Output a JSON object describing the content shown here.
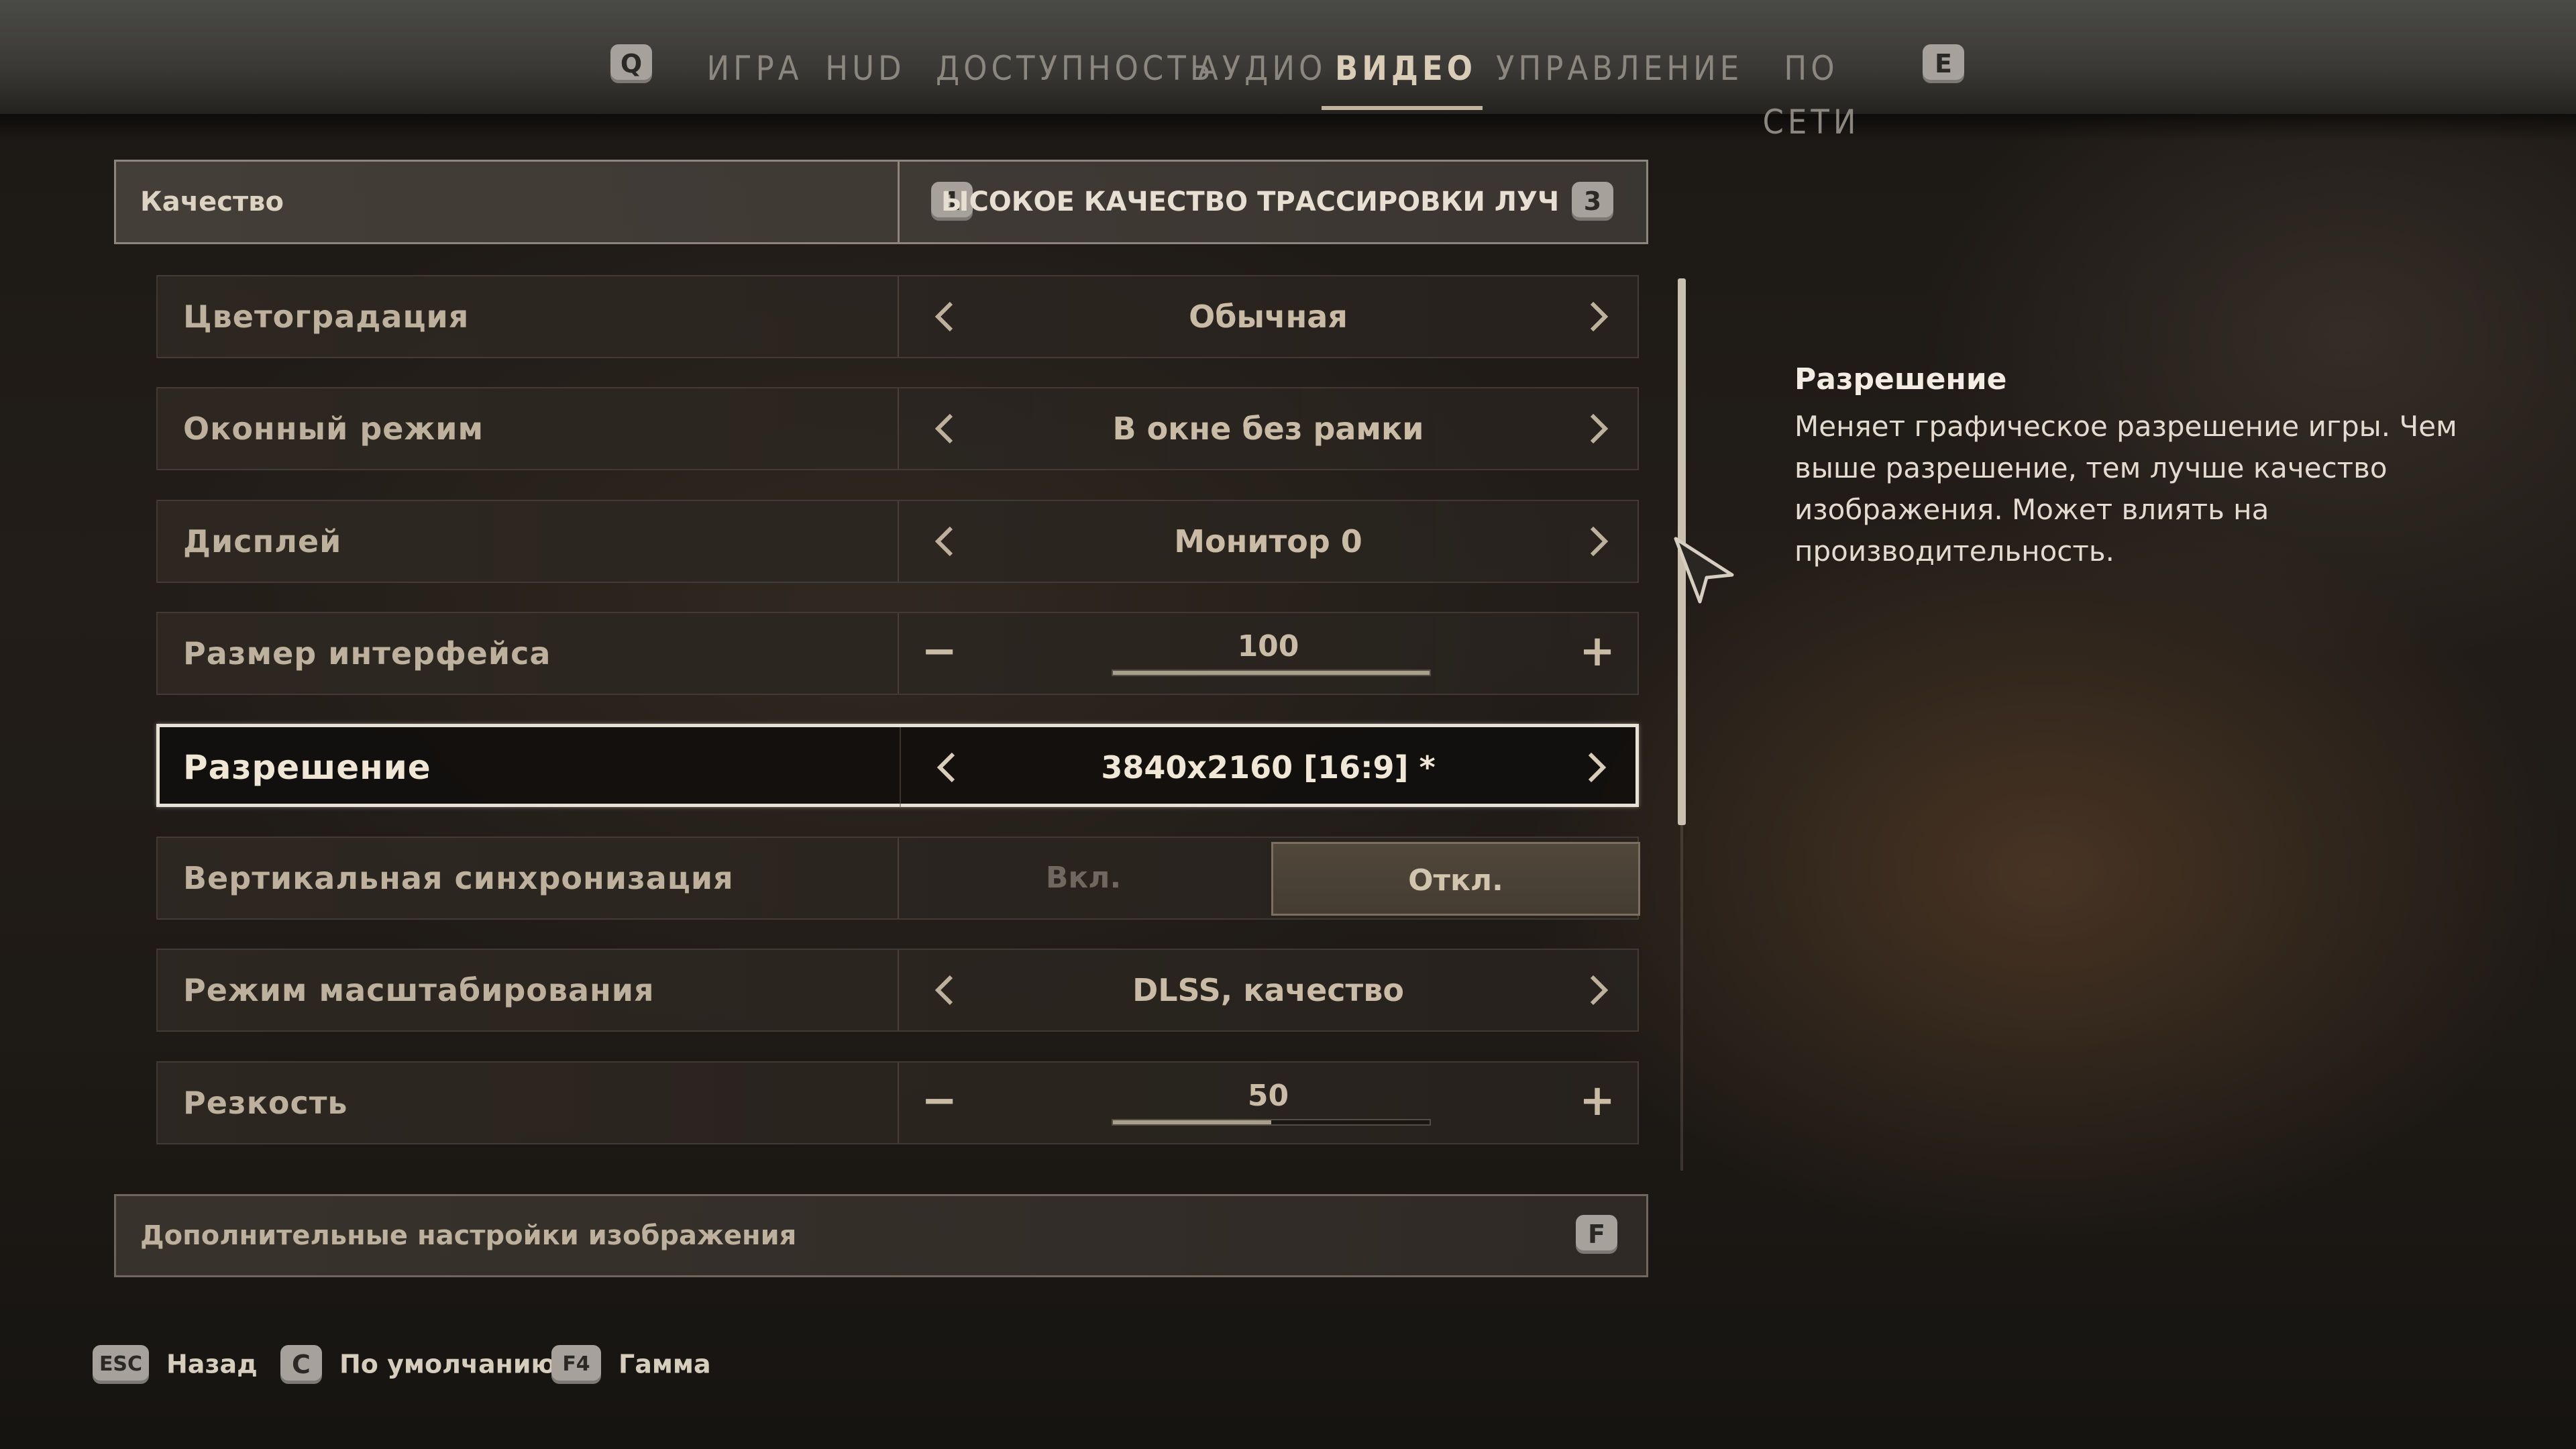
{
  "nav": {
    "prev_key": "Q",
    "next_key": "E",
    "tabs": [
      {
        "label": "ИГРА"
      },
      {
        "label": "HUD"
      },
      {
        "label": "ДОСТУПНОСТЬ"
      },
      {
        "label": "АУДИО"
      },
      {
        "label": "ВИДЕО"
      },
      {
        "label": "УПРАВЛЕНИЕ"
      },
      {
        "label": "ПО СЕТИ"
      }
    ],
    "active_tab": "ВИДЕО"
  },
  "quality": {
    "label": "Качество",
    "value": "ЫСОКОЕ КАЧЕСТВО ТРАССИРОВКИ ЛУЧЕЙ",
    "prev_key": "1",
    "next_key": "3"
  },
  "settings": {
    "color_grading": {
      "label": "Цветоградация",
      "value": "Обычная"
    },
    "window_mode": {
      "label": "Оконный режим",
      "value": "В окне без рамки"
    },
    "display": {
      "label": "Дисплей",
      "value": "Монитор 0"
    },
    "ui_size": {
      "label": "Размер интерфейса",
      "value": "100",
      "fill_percent": 100,
      "minus": "−",
      "plus": "+"
    },
    "resolution": {
      "label": "Разрешение",
      "value": "3840x2160 [16:9] *"
    },
    "vsync": {
      "label": "Вертикальная синхронизация",
      "on": "Вкл.",
      "off": "Откл.",
      "selected": "Откл."
    },
    "scaling_mode": {
      "label": "Режим масштабирования",
      "value": "DLSS, качество"
    },
    "sharpness": {
      "label": "Резкость",
      "value": "50",
      "fill_percent": 50,
      "minus": "−",
      "plus": "+"
    }
  },
  "advanced": {
    "label": "Дополнительные настройки изображения",
    "key": "F"
  },
  "description": {
    "title": "Разрешение",
    "body": "Меняет графическое разрешение игры. Чем выше разрешение, тем лучше качество изображения. Может влиять на производительность."
  },
  "hints": [
    {
      "key": "ESC",
      "label": "Назад"
    },
    {
      "key": "C",
      "label": "По умолчанию"
    },
    {
      "key": "F4",
      "label": "Гамма"
    }
  ],
  "colors": {
    "selected_border": "#e8e2d6",
    "accent_text": "#c9bba5"
  }
}
